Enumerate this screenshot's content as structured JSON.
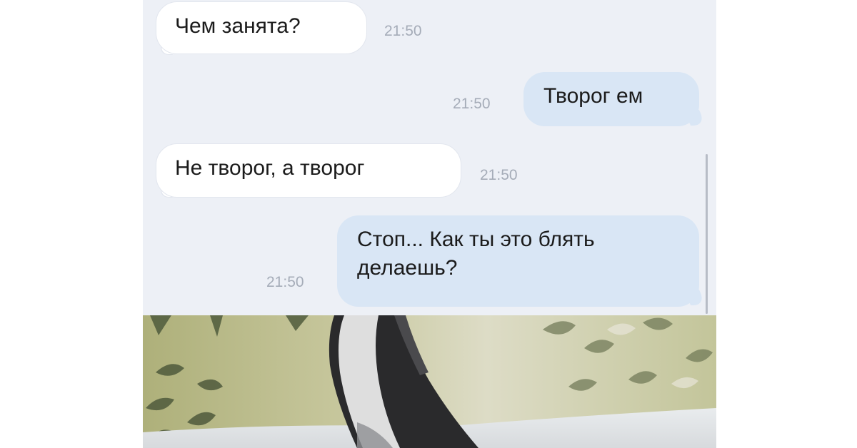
{
  "messages": [
    {
      "direction": "incoming",
      "text": "Чем занята?",
      "time": "21:50"
    },
    {
      "direction": "outgoing",
      "text": "Творог ем",
      "time": "21:50"
    },
    {
      "direction": "incoming",
      "text": "Не творог, а творог",
      "time": "21:50"
    },
    {
      "direction": "outgoing",
      "lines": [
        "Стоп... Как ты это блять",
        "делаешь?"
      ],
      "time": "21:50"
    }
  ],
  "attachment": {
    "type": "photo",
    "subject": "cat photo against floral wallpaper",
    "icon": "photo-attachment"
  },
  "colors": {
    "chat_background": "#edf0f6",
    "incoming_bubble": "#ffffff",
    "outgoing_bubble": "#d9e6f5",
    "timestamp": "#a5acb8"
  }
}
